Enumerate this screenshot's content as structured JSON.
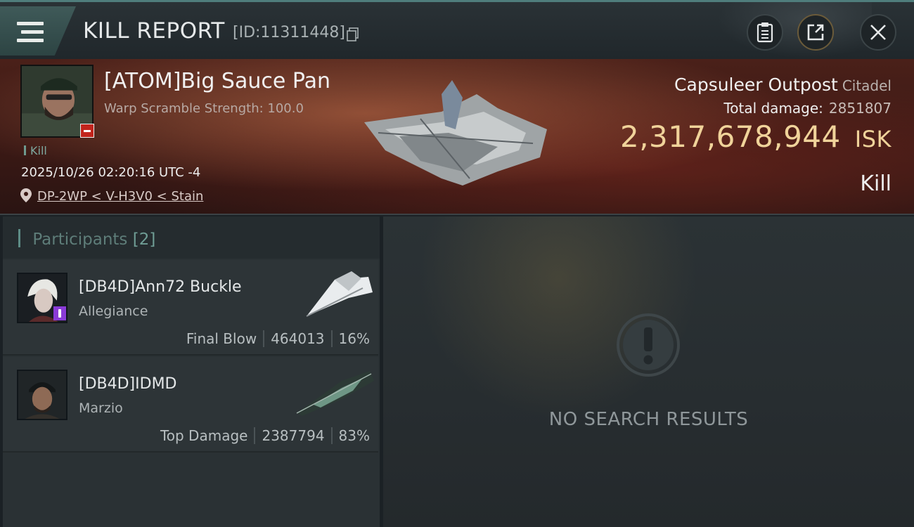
{
  "header": {
    "title": "KILL REPORT",
    "report_id": "[ID:11311448]",
    "icons": {
      "menu": "menu-icon",
      "copy": "copy-icon",
      "clipboard": "clipboard-icon",
      "share": "share-icon",
      "close": "close-icon"
    }
  },
  "victim": {
    "name": "[ATOM]Big Sauce Pan",
    "subtitle": "Warp Scramble Strength: 100.0",
    "tag": "Kill",
    "timestamp": "2025/10/26 02:20:16 UTC -4",
    "location": "DP-2WP < V-H3V0 < Stain"
  },
  "target": {
    "name": "Capsuleer Outpost",
    "class": "Citadel",
    "total_damage_label": "Total damage:",
    "total_damage": "2851807",
    "isk_value": "2,317,678,944",
    "isk_unit": "ISK",
    "result": "Kill"
  },
  "participants": {
    "label": "Participants",
    "count": "[2]",
    "items": [
      {
        "name": "[DB4D]Ann72 Buckle",
        "corp": "Allegiance",
        "role": "Final Blow",
        "damage": "464013",
        "percent": "16%"
      },
      {
        "name": "[DB4D]IDMD",
        "corp": "Marzio",
        "role": "Top Damage",
        "damage": "2387794",
        "percent": "83%"
      }
    ]
  },
  "empty_state": {
    "message": "NO SEARCH RESULTS",
    "icon": "alert-icon"
  },
  "colors": {
    "accent": "#5d8c86",
    "isk": "#f0d39a",
    "victim_badge": "#c2241c",
    "participant_badge": "#8a3bd6"
  }
}
